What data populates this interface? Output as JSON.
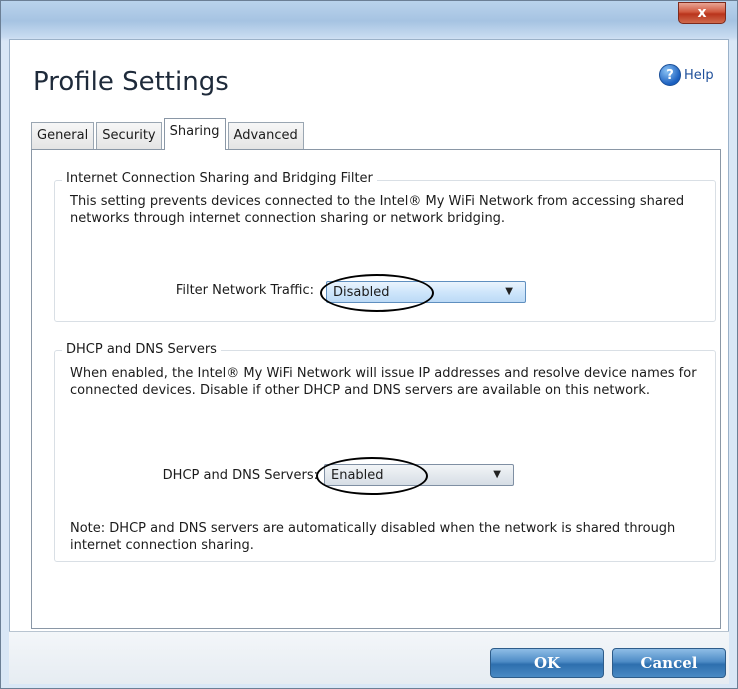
{
  "window": {
    "close_glyph": "x"
  },
  "header": {
    "title": "Profile Settings",
    "help_label": "Help",
    "help_icon_glyph": "?"
  },
  "tabs": [
    {
      "label": "General",
      "active": false
    },
    {
      "label": "Security",
      "active": false
    },
    {
      "label": "Sharing",
      "active": true
    },
    {
      "label": "Advanced",
      "active": false
    }
  ],
  "sharing_group": {
    "title": "Internet Connection Sharing and Bridging Filter",
    "description": "This setting prevents devices connected to the Intel® My WiFi Network from accessing shared networks through internet connection sharing or network bridging.",
    "filter_label": "Filter Network Traffic:",
    "filter_value": "Disabled"
  },
  "dhcp_group": {
    "title": "DHCP and DNS Servers",
    "description": "When enabled, the Intel® My WiFi Network will issue IP addresses and resolve device names for connected devices.  Disable if other DHCP and DNS servers are available on this network.",
    "servers_label": "DHCP and DNS Servers:",
    "servers_value": "Enabled",
    "note": "Note: DHCP and DNS servers are automatically disabled when the network is shared through internet connection sharing."
  },
  "footer": {
    "ok_label": "OK",
    "cancel_label": "Cancel"
  },
  "colors": {
    "button_blue": "#4e8cc6",
    "close_red": "#c9452a",
    "annotation_ellipse": "#000000"
  }
}
